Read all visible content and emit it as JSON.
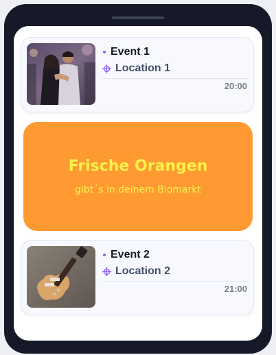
{
  "events": [
    {
      "title": "Event 1",
      "location": "Location 1",
      "time": "20:00",
      "image_icon": "dancing-couple-photo"
    },
    {
      "title": "Event 2",
      "location": "Location 2",
      "time": "21:00",
      "image_icon": "electric-guitar-photo"
    }
  ],
  "ad": {
    "headline": "Frische Orangen",
    "subline": "gibt´s in deinem Biomarkt",
    "background_color": "#ff9a33",
    "text_color": "#fdf24b"
  },
  "colors": {
    "accent": "#8b5cf6",
    "device_frame": "#161a28"
  }
}
